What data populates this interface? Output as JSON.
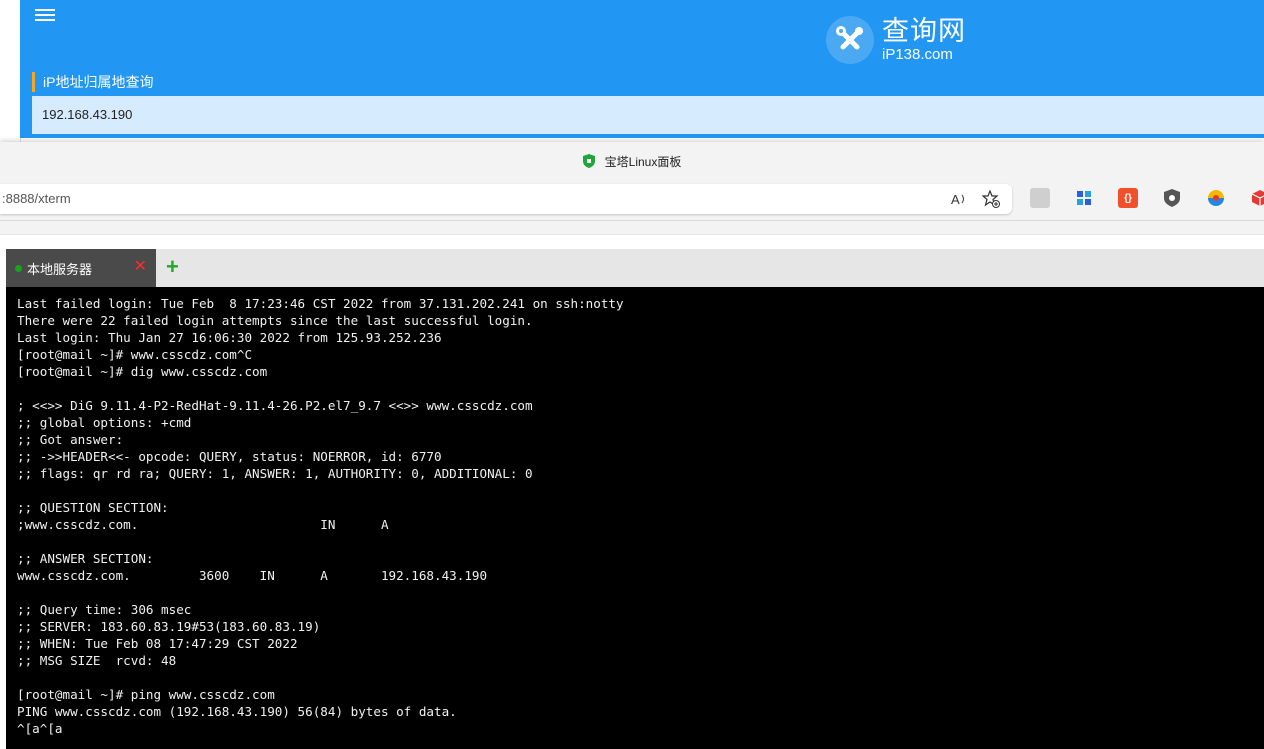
{
  "ip_page": {
    "logo_cn": "查询网",
    "logo_en": "iP138.com",
    "section_title": "iP地址归属地查询",
    "result_ip": "192.168.43.190"
  },
  "browser": {
    "tab_title": "宝塔Linux面板",
    "address": ":8888/xterm",
    "colors": {
      "accent": "#2196f3",
      "terminal_bg": "#000000",
      "tab_bg": "#4a4a4a"
    }
  },
  "terminal_tabs": [
    {
      "label": "本地服务器",
      "close": "✕"
    }
  ],
  "add_tab": "+",
  "terminal": {
    "lines": [
      "Last failed login: Tue Feb  8 17:23:46 CST 2022 from 37.131.202.241 on ssh:notty",
      "There were 22 failed login attempts since the last successful login.",
      "Last login: Thu Jan 27 16:06:30 2022 from 125.93.252.236",
      "[root@mail ~]# www.csscdz.com^C",
      "[root@mail ~]# dig www.csscdz.com",
      "",
      "; <<>> DiG 9.11.4-P2-RedHat-9.11.4-26.P2.el7_9.7 <<>> www.csscdz.com",
      ";; global options: +cmd",
      ";; Got answer:",
      ";; ->>HEADER<<- opcode: QUERY, status: NOERROR, id: 6770",
      ";; flags: qr rd ra; QUERY: 1, ANSWER: 1, AUTHORITY: 0, ADDITIONAL: 0",
      "",
      ";; QUESTION SECTION:",
      ";www.csscdz.com.                        IN      A",
      "",
      ";; ANSWER SECTION:",
      "www.csscdz.com.         3600    IN      A       192.168.43.190",
      "",
      ";; Query time: 306 msec",
      ";; SERVER: 183.60.83.19#53(183.60.83.19)",
      ";; WHEN: Tue Feb 08 17:47:29 CST 2022",
      ";; MSG SIZE  rcvd: 48",
      "",
      "[root@mail ~]# ping www.csscdz.com",
      "PING www.csscdz.com (192.168.43.190) 56(84) bytes of data.",
      "^[a^[a"
    ]
  }
}
